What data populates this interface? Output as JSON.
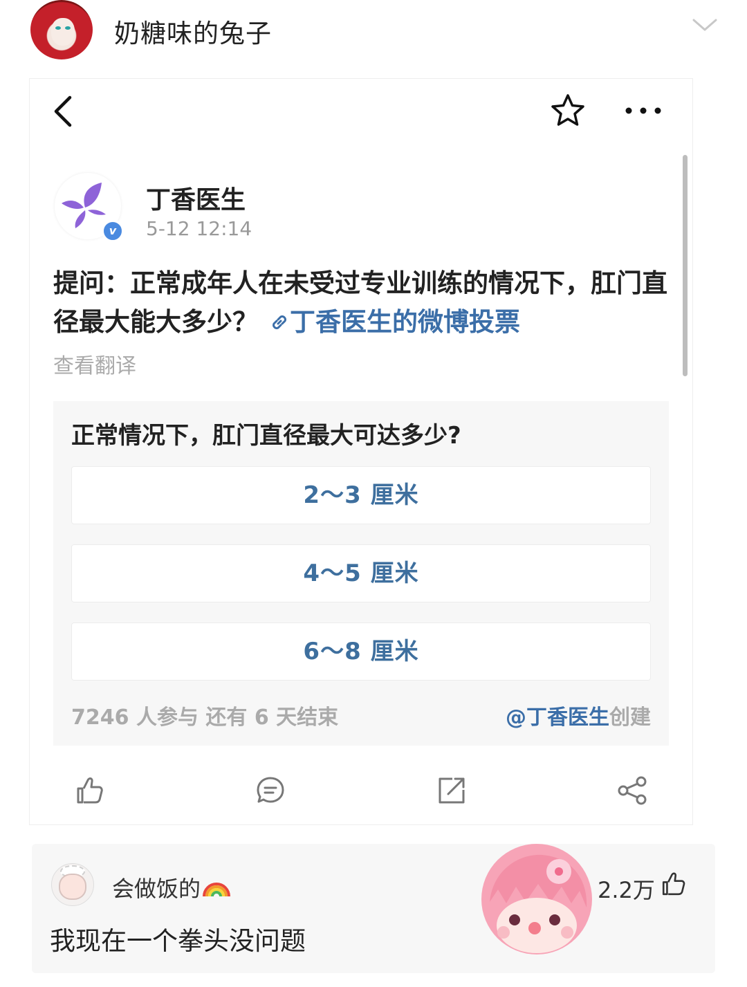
{
  "header": {
    "username": "奶糖味的兔子"
  },
  "post": {
    "author": "丁香医生",
    "time": "5-12 12:14",
    "text": "提问：正常成年人在未受过专业训练的情况下，肛门直径最大能大多少？",
    "link_text": "丁香医生的微博投票",
    "translate_label": "查看翻译",
    "verified_badge": "v"
  },
  "poll": {
    "question": "正常情况下，肛门直径最大可达多少?",
    "options": [
      {
        "label": "2～3 厘米"
      },
      {
        "label": "4～5 厘米"
      },
      {
        "label": "6～8 厘米"
      }
    ],
    "stats": "7246 人参与  还有 6 天结束",
    "creator_handle": "@丁香医生",
    "creator_suffix": "创建"
  },
  "actions": {
    "icons": [
      "thumb-up-icon",
      "comment-icon",
      "repost-icon",
      "share-icon"
    ]
  },
  "comment": {
    "author": "会做饭的",
    "text": "我现在一个拳头没问题",
    "likes": "2.2万"
  },
  "colors": {
    "link": "#3b6ea8",
    "option_text": "#3e6f9e",
    "muted": "#aaaaaa",
    "verified": "#4a8ae0",
    "logo": "#8e63d8"
  }
}
